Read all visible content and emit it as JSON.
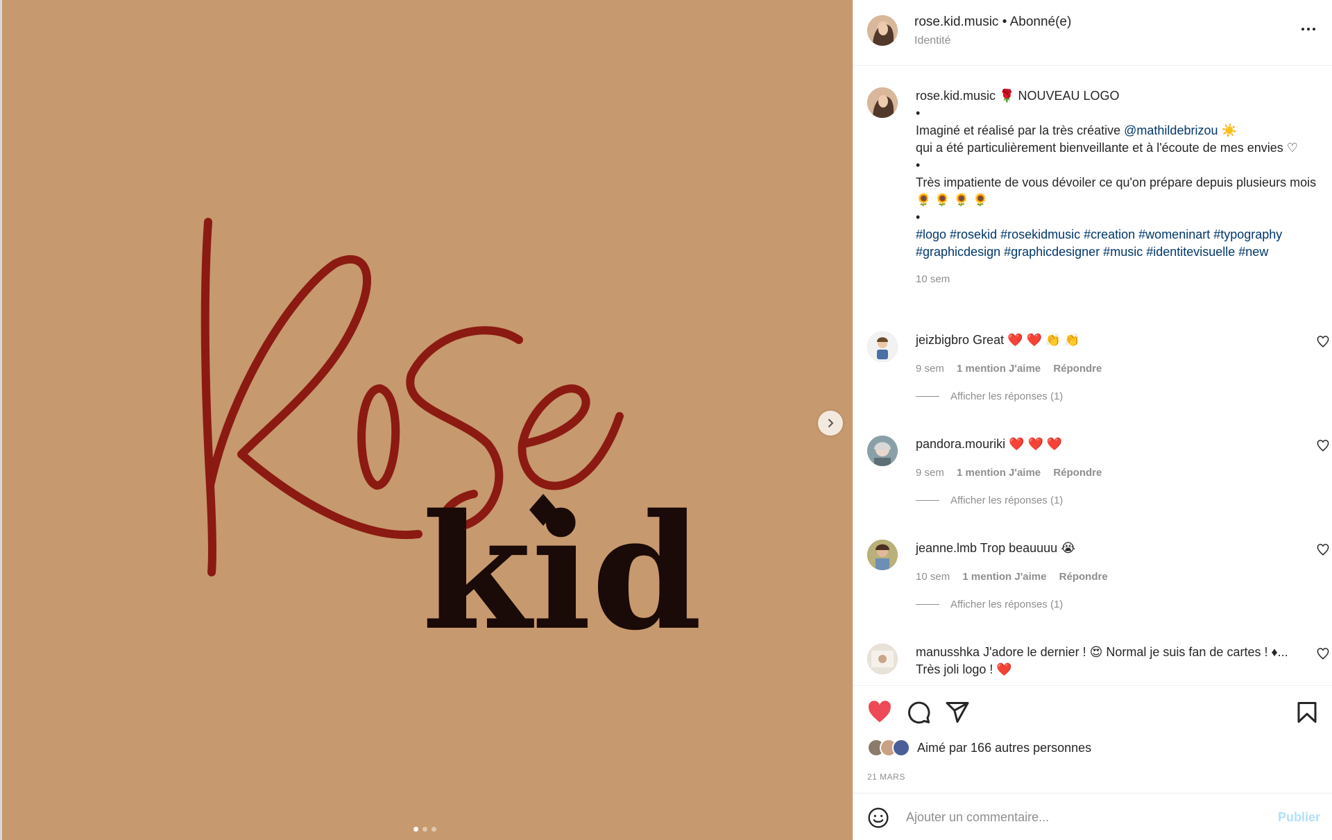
{
  "post": {
    "username": "rose.kid.music",
    "separator": "•",
    "follow_status": "Abonné(e)",
    "subtitle": "Identité"
  },
  "media": {
    "logo_script": "Rose",
    "logo_serif": "kid",
    "background_color": "#c7996e",
    "script_color": "#8b1a12",
    "serif_color": "#1a0a08",
    "slides_total": 3,
    "slide_active": 1
  },
  "caption": {
    "username": "rose.kid.music",
    "line1": "🌹 NOUVEAU LOGO",
    "bullet": "•",
    "line2a": "Imaginé et réalisé par la très créative ",
    "mention": "@mathildebrizou",
    "line2b": " ☀️",
    "line3": "qui a été particulièrement bienveillante et à l'écoute de mes envies ♡",
    "line4": "Très impatiente de vous dévoiler ce qu'on prépare depuis plusieurs mois 🌻 🌻 🌻 🌻",
    "hashtags": "#logo #rosekid #rosekidmusic #creation #womeninart #typography #graphicdesign #graphicdesigner #music #identitevisuelle #new",
    "time": "10 sem"
  },
  "comments": [
    {
      "username": "jeizbigbro",
      "text": "Great ❤️ ❤️ 👏 👏",
      "time": "9 sem",
      "likes": "1 mention J'aime",
      "reply": "Répondre",
      "replies": "Afficher les réponses (1)"
    },
    {
      "username": "pandora.mouriki",
      "text": "❤️ ❤️ ❤️",
      "time": "9 sem",
      "likes": "1 mention J'aime",
      "reply": "Répondre",
      "replies": "Afficher les réponses (1)"
    },
    {
      "username": "jeanne.lmb",
      "text": "Trop beauuuu 😭",
      "time": "10 sem",
      "likes": "1 mention J'aime",
      "reply": "Répondre",
      "replies": "Afficher les réponses (1)"
    },
    {
      "username": "manusshka",
      "text": "J'adore le dernier ! 😍 Normal je suis fan de cartes ! ♦... Très joli logo ! ❤️"
    }
  ],
  "actions": {
    "like_icon": "heart-filled-icon",
    "comment_icon": "comment-icon",
    "share_icon": "send-icon",
    "save_icon": "bookmark-icon",
    "like_color": "#ed4956"
  },
  "likes": {
    "prefix": "Aimé par ",
    "count": "166 autres personnes"
  },
  "date": "21 MARS",
  "add_comment": {
    "placeholder": "Ajouter un commentaire...",
    "publish": "Publier"
  }
}
